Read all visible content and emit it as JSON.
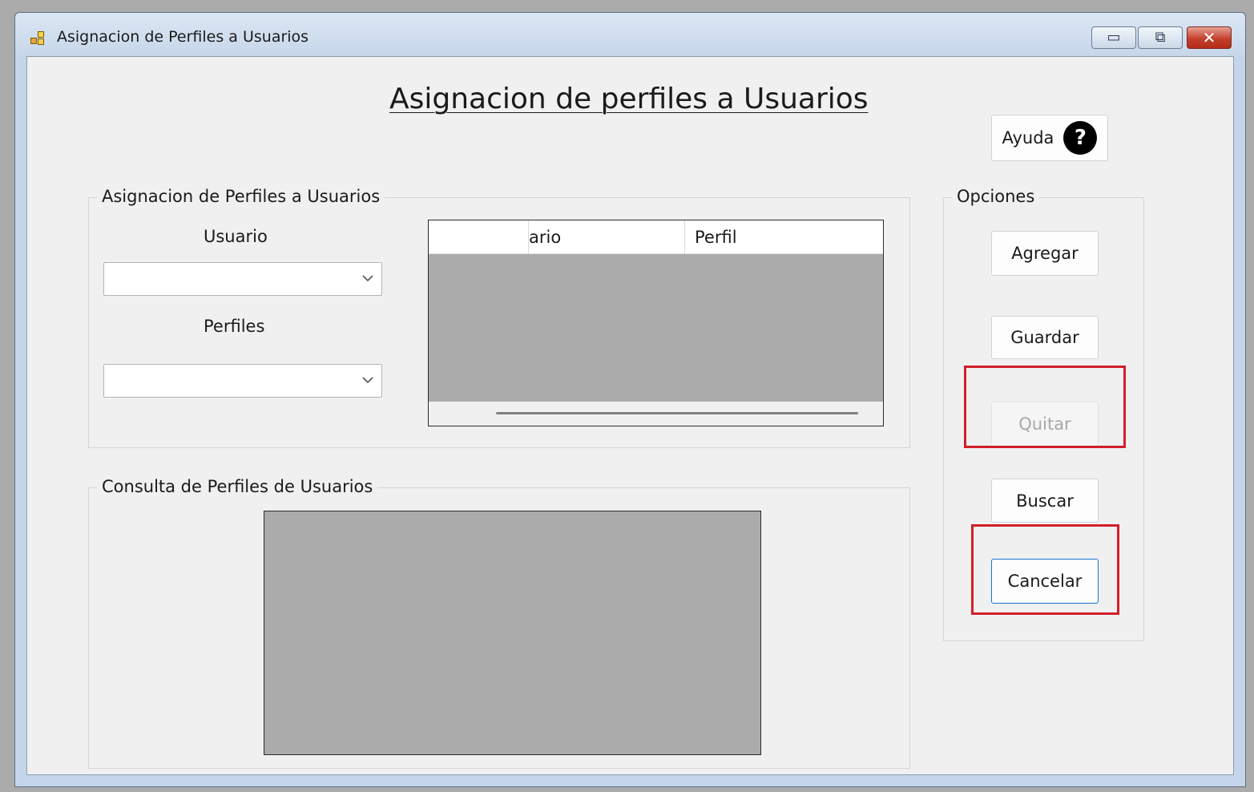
{
  "window": {
    "title": "Asignacion de Perfiles a Usuarios",
    "controls": {
      "minimize": "▭",
      "maximize": "⧉",
      "close": "✕"
    }
  },
  "heading": "Asignacion de perfiles a Usuarios",
  "help_button": {
    "label": "Ayuda",
    "icon": "question-circle-icon",
    "glyph": "?"
  },
  "assign_group": {
    "legend": "Asignacion de Perfiles a Usuarios",
    "usuario_label": "Usuario",
    "usuario_value": "",
    "perfiles_label": "Perfiles",
    "perfiles_value": "",
    "grid": {
      "columns": [
        "",
        "ario",
        "Perfil"
      ],
      "rows": []
    }
  },
  "query_group": {
    "legend": "Consulta de Perfiles de Usuarios",
    "rows": []
  },
  "options": {
    "legend": "Opciones",
    "buttons": [
      {
        "label": "Agregar",
        "state": "enabled"
      },
      {
        "label": "Guardar",
        "state": "enabled"
      },
      {
        "label": "Quitar",
        "state": "disabled"
      },
      {
        "label": "Buscar",
        "state": "enabled"
      },
      {
        "label": "Cancelar",
        "state": "focused"
      }
    ]
  },
  "colors": {
    "highlight": "#d11f2a",
    "focus": "#1874d0",
    "grid_background": "#ababab"
  }
}
